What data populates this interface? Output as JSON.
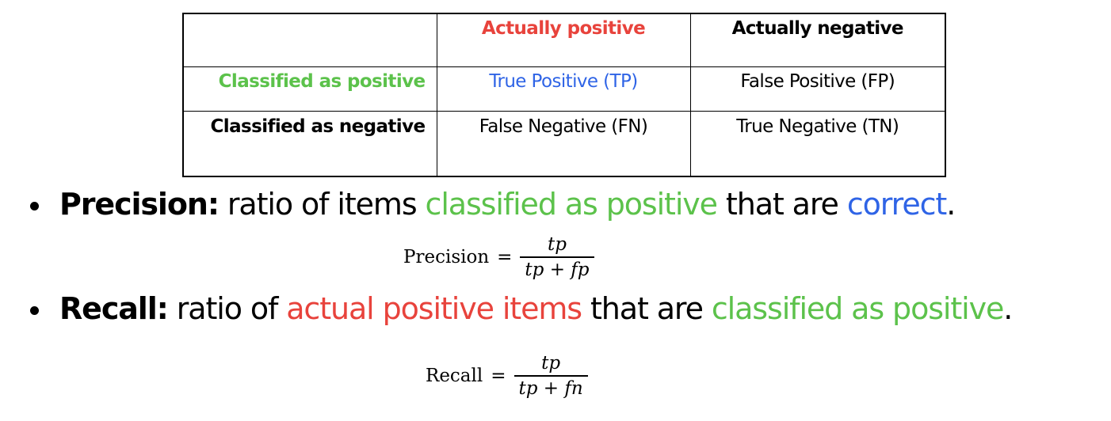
{
  "colors": {
    "red": "#e8433c",
    "green": "#5cc24b",
    "blue": "#2f64e6",
    "black": "#000000"
  },
  "table": {
    "corner": "",
    "col_headers": [
      "Actually positive",
      "Actually negative"
    ],
    "row_headers": [
      "Classified as positive",
      "Classified as negative"
    ],
    "cells": [
      [
        "True Positive (TP)",
        "False Positive (FP)"
      ],
      [
        "False Negative (FN)",
        "True Negative (TN)"
      ]
    ]
  },
  "precision": {
    "term": "Precision:",
    "text_1": " ratio of items ",
    "highlight_1": "classified as positive",
    "text_2": " that are ",
    "highlight_2": "correct",
    "text_3": ".",
    "formula": {
      "lhs": "Precision",
      "eq": "=",
      "numerator": "tp",
      "denominator": "tp + fp"
    }
  },
  "recall": {
    "term": "Recall:",
    "text_1": " ratio of ",
    "highlight_1": "actual positive items",
    "text_2": " that are ",
    "highlight_2": "classified as positive",
    "text_3": ".",
    "formula": {
      "lhs": "Recall",
      "eq": "=",
      "numerator": "tp",
      "denominator": "tp + fn"
    }
  }
}
